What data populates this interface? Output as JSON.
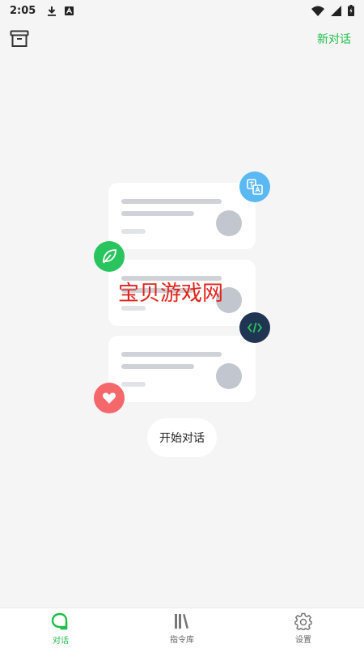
{
  "status_bar": {
    "time": "2:05"
  },
  "header": {
    "new_chat_label": "新对话"
  },
  "illustration": {
    "watermark": "宝贝游戏网",
    "start_chat_label": "开始对话"
  },
  "tabs": [
    {
      "label": "对话",
      "icon": "chat-icon",
      "active": true
    },
    {
      "label": "指令库",
      "icon": "library-icon",
      "active": false
    },
    {
      "label": "设置",
      "icon": "gear-icon",
      "active": false
    }
  ],
  "colors": {
    "accent": "#1fbf4b",
    "badge_translate": "#5ab8f2",
    "badge_leaf": "#2ac45e",
    "badge_code": "#1f3552",
    "badge_heart": "#f4676a",
    "watermark": "#e2231a"
  }
}
